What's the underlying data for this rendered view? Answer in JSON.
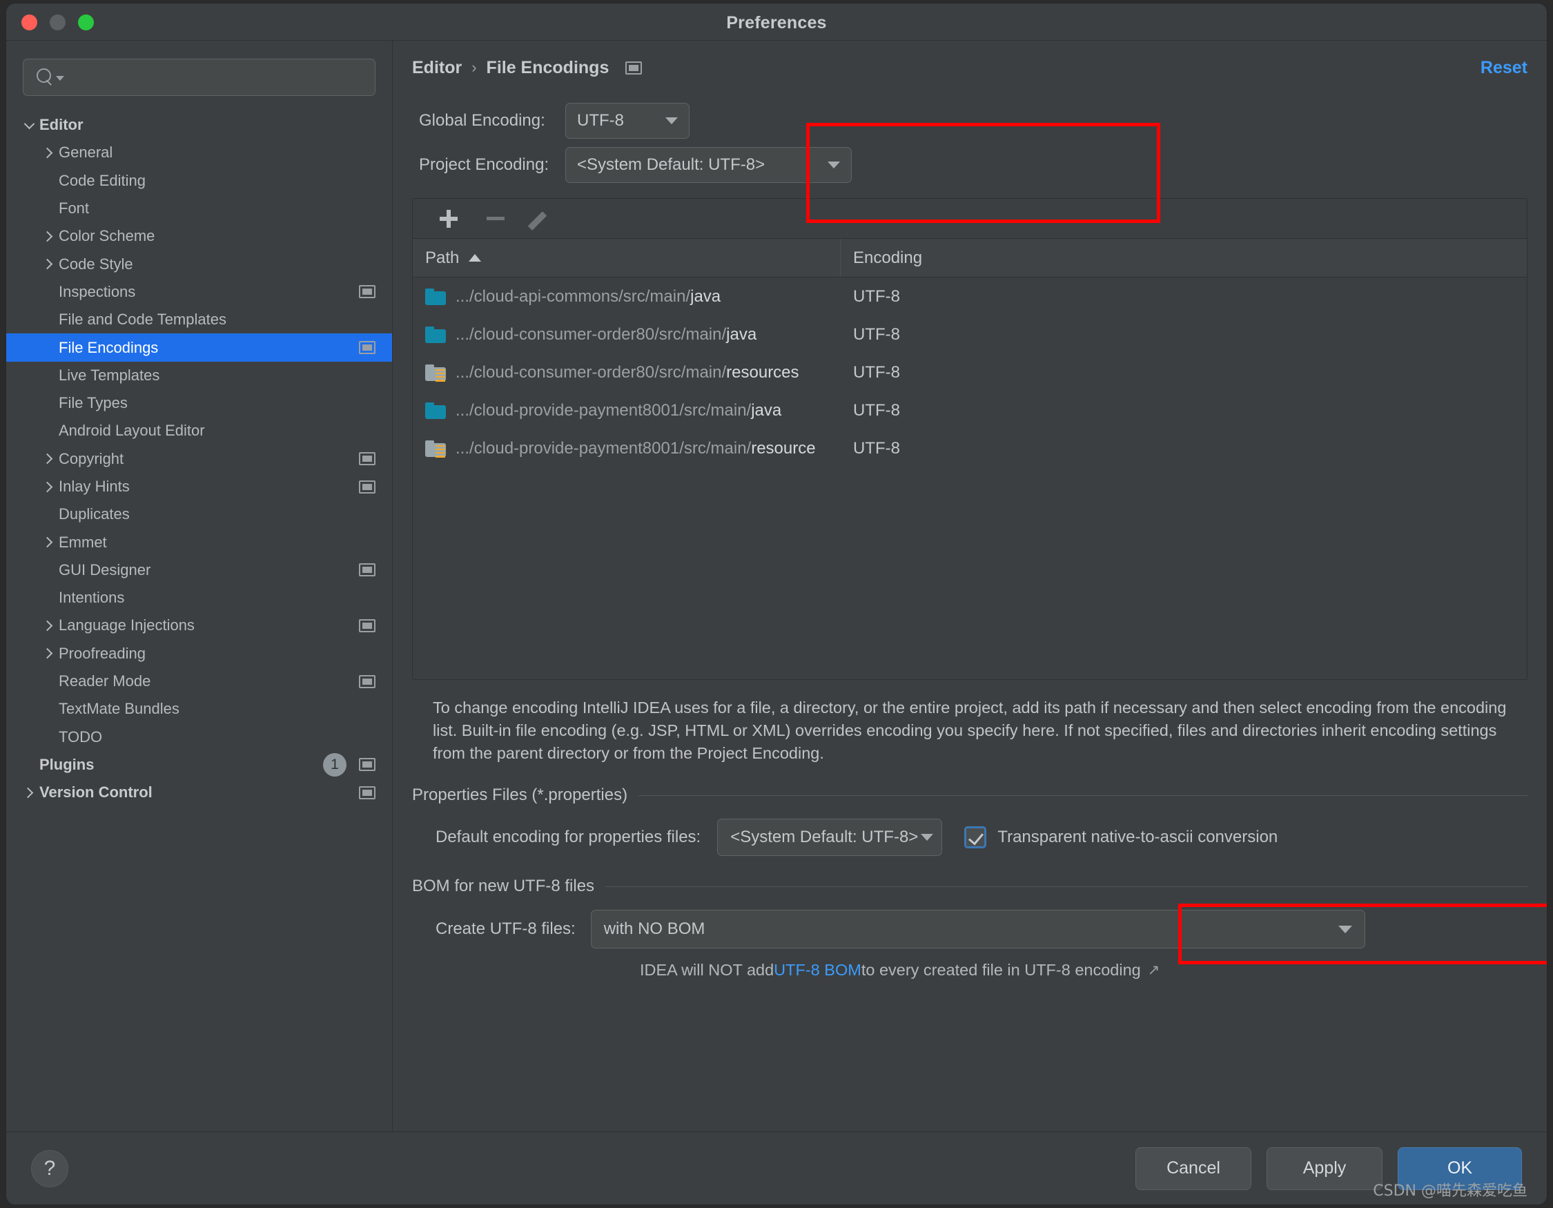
{
  "window": {
    "title": "Preferences"
  },
  "search": {
    "value": "",
    "placeholder": ""
  },
  "sidebar": {
    "items": [
      {
        "label": "Editor",
        "indent": 0,
        "chevron": "down",
        "bold": true,
        "cfg": false
      },
      {
        "label": "General",
        "indent": 1,
        "chevron": "right",
        "bold": false,
        "cfg": false
      },
      {
        "label": "Code Editing",
        "indent": 1,
        "chevron": "none",
        "bold": false,
        "cfg": false
      },
      {
        "label": "Font",
        "indent": 1,
        "chevron": "none",
        "bold": false,
        "cfg": false
      },
      {
        "label": "Color Scheme",
        "indent": 1,
        "chevron": "right",
        "bold": false,
        "cfg": false
      },
      {
        "label": "Code Style",
        "indent": 1,
        "chevron": "right",
        "bold": false,
        "cfg": false
      },
      {
        "label": "Inspections",
        "indent": 1,
        "chevron": "none",
        "bold": false,
        "cfg": true
      },
      {
        "label": "File and Code Templates",
        "indent": 1,
        "chevron": "none",
        "bold": false,
        "cfg": false
      },
      {
        "label": "File Encodings",
        "indent": 1,
        "chevron": "none",
        "bold": false,
        "cfg": true,
        "selected": true
      },
      {
        "label": "Live Templates",
        "indent": 1,
        "chevron": "none",
        "bold": false,
        "cfg": false
      },
      {
        "label": "File Types",
        "indent": 1,
        "chevron": "none",
        "bold": false,
        "cfg": false
      },
      {
        "label": "Android Layout Editor",
        "indent": 1,
        "chevron": "none",
        "bold": false,
        "cfg": false
      },
      {
        "label": "Copyright",
        "indent": 1,
        "chevron": "right",
        "bold": false,
        "cfg": true
      },
      {
        "label": "Inlay Hints",
        "indent": 1,
        "chevron": "right",
        "bold": false,
        "cfg": true
      },
      {
        "label": "Duplicates",
        "indent": 1,
        "chevron": "none",
        "bold": false,
        "cfg": false
      },
      {
        "label": "Emmet",
        "indent": 1,
        "chevron": "right",
        "bold": false,
        "cfg": false
      },
      {
        "label": "GUI Designer",
        "indent": 1,
        "chevron": "none",
        "bold": false,
        "cfg": true
      },
      {
        "label": "Intentions",
        "indent": 1,
        "chevron": "none",
        "bold": false,
        "cfg": false
      },
      {
        "label": "Language Injections",
        "indent": 1,
        "chevron": "right",
        "bold": false,
        "cfg": true
      },
      {
        "label": "Proofreading",
        "indent": 1,
        "chevron": "right",
        "bold": false,
        "cfg": false
      },
      {
        "label": "Reader Mode",
        "indent": 1,
        "chevron": "none",
        "bold": false,
        "cfg": true
      },
      {
        "label": "TextMate Bundles",
        "indent": 1,
        "chevron": "none",
        "bold": false,
        "cfg": false
      },
      {
        "label": "TODO",
        "indent": 1,
        "chevron": "none",
        "bold": false,
        "cfg": false
      },
      {
        "label": "Plugins",
        "indent": 0,
        "chevron": "none",
        "bold": true,
        "cfg": true,
        "badge": "1"
      },
      {
        "label": "Version Control",
        "indent": 0,
        "chevron": "right",
        "bold": true,
        "cfg": true
      }
    ]
  },
  "header": {
    "crumb_root": "Editor",
    "crumb_sep": "›",
    "crumb_leaf": "File Encodings",
    "reset_label": "Reset"
  },
  "encoding": {
    "global_label": "Global Encoding:",
    "global_value": "UTF-8",
    "project_label": "Project Encoding:",
    "project_value": "<System Default: UTF-8>"
  },
  "toolbar": {
    "add_label": "+",
    "remove_label": "−",
    "edit_label": "edit"
  },
  "table": {
    "columns": [
      "Path",
      "Encoding"
    ],
    "sort_column": "Path",
    "sort_direction": "asc",
    "rows": [
      {
        "icon": "folder-source",
        "path_dim": ".../cloud-api-commons/src/main/",
        "path_strong": "java",
        "encoding": "UTF-8"
      },
      {
        "icon": "folder-source",
        "path_dim": ".../cloud-consumer-order80/src/main/",
        "path_strong": "java",
        "encoding": "UTF-8"
      },
      {
        "icon": "folder-resource",
        "path_dim": ".../cloud-consumer-order80/src/main/",
        "path_strong": "resources",
        "encoding": "UTF-8"
      },
      {
        "icon": "folder-source",
        "path_dim": ".../cloud-provide-payment8001/src/main/",
        "path_strong": "java",
        "encoding": "UTF-8"
      },
      {
        "icon": "folder-resource",
        "path_dim": ".../cloud-provide-payment8001/src/main/",
        "path_strong": "resource",
        "encoding": "UTF-8"
      }
    ]
  },
  "description": "To change encoding IntelliJ IDEA uses for a file, a directory, or the entire project, add its path if necessary and then select encoding from the encoding list. Built-in file encoding (e.g. JSP, HTML or XML) overrides encoding you specify here. If not specified, files and directories inherit encoding settings from the parent directory or from the Project Encoding.",
  "properties_section": {
    "title": "Properties Files (*.properties)",
    "field_label": "Default encoding for properties files:",
    "field_value": "<System Default: UTF-8>",
    "checkbox_label": "Transparent native-to-ascii conversion",
    "checkbox_checked": true
  },
  "bom_section": {
    "title": "BOM for new UTF-8 files",
    "field_label": "Create UTF-8 files:",
    "field_value": "with NO BOM",
    "hint_prefix": "IDEA will NOT add ",
    "hint_link": "UTF-8 BOM",
    "hint_suffix": " to every created file in UTF-8 encoding",
    "hint_arrow": "↗"
  },
  "footer": {
    "help_label": "?",
    "cancel_label": "Cancel",
    "apply_label": "Apply",
    "ok_label": "OK"
  },
  "watermark": "CSDN @喵先森爱吃鱼",
  "colors": {
    "accent_blue": "#1f6feb",
    "link_blue": "#3b9cff",
    "annotation_red": "#ff0000",
    "folder_source": "#128bab",
    "folder_resource": "#9aa7ad"
  }
}
